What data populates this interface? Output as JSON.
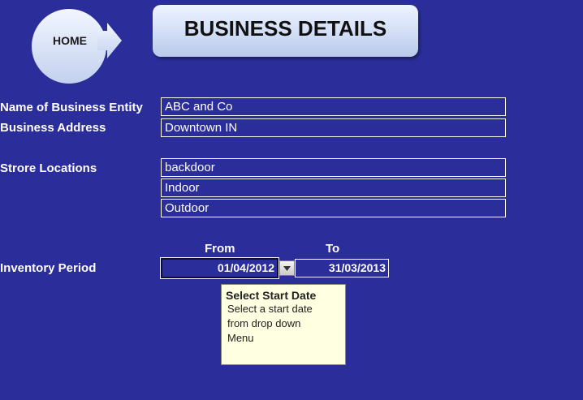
{
  "nav": {
    "home_label": "HOME"
  },
  "header": {
    "title": "BUSINESS DETAILS"
  },
  "form": {
    "business_name": {
      "label": "Name of Business Entity",
      "value": "ABC and Co"
    },
    "business_address": {
      "label": "Business Address",
      "value": "Downtown IN"
    },
    "store_locations": {
      "label": "Strore Locations",
      "values": [
        "backdoor",
        "Indoor",
        "Outdoor"
      ]
    },
    "inventory_period": {
      "label": "Inventory Period",
      "from_header": "From",
      "to_header": "To",
      "from_value": "01/04/2012",
      "to_value": "31/03/2013"
    }
  },
  "tooltip": {
    "title": "Select Start Date",
    "lines": [
      "Select a start date",
      "from drop down",
      "Menu"
    ]
  },
  "colors": {
    "background": "#2b2e9a",
    "tooltip_bg": "#ffffe1"
  }
}
